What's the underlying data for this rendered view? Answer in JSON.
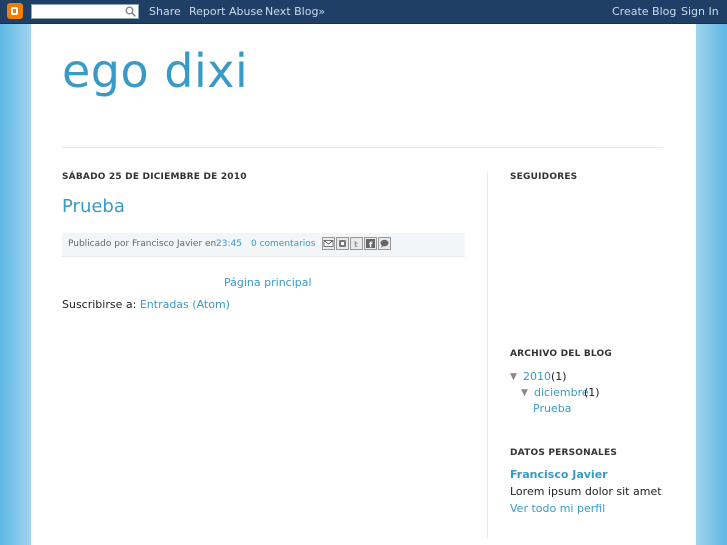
{
  "navbar": {
    "search_placeholder": "",
    "share": "Share",
    "report_abuse": "Report Abuse",
    "next_blog": "Next Blog»",
    "create_blog": "Create Blog",
    "sign_in": "Sign In"
  },
  "blog": {
    "title": "ego dixi"
  },
  "post": {
    "date": "SÁBADO 25 DE DICIEMBRE DE 2010",
    "title": "Prueba",
    "posted_by": "Publicado por Francisco Javier en",
    "time": "23:45",
    "comments": "0 comentarios",
    "share_icons": [
      "email-icon",
      "blogthis-icon",
      "twitter-icon",
      "facebook-icon",
      "buzz-icon"
    ]
  },
  "nav": {
    "home": "Página principal"
  },
  "subscribe": {
    "label": "Suscribirse a:",
    "link": "Entradas (Atom)"
  },
  "sidebar": {
    "followers_heading": "SEGUIDORES",
    "archive_heading": "ARCHIVO DEL BLOG",
    "archive_year": "2010",
    "archive_year_count": "(1)",
    "archive_month": "diciembre",
    "archive_month_count": "(1)",
    "archive_post": "Prueba",
    "profile_heading": "DATOS PERSONALES",
    "profile_name": "Francisco Javier",
    "profile_about": "Lorem ipsum dolor sit amet",
    "profile_link": "Ver todo mi perfil"
  },
  "colors": {
    "link": "#3a9ac7",
    "navbar": "#1f3f66",
    "logo": "#f57d00"
  }
}
